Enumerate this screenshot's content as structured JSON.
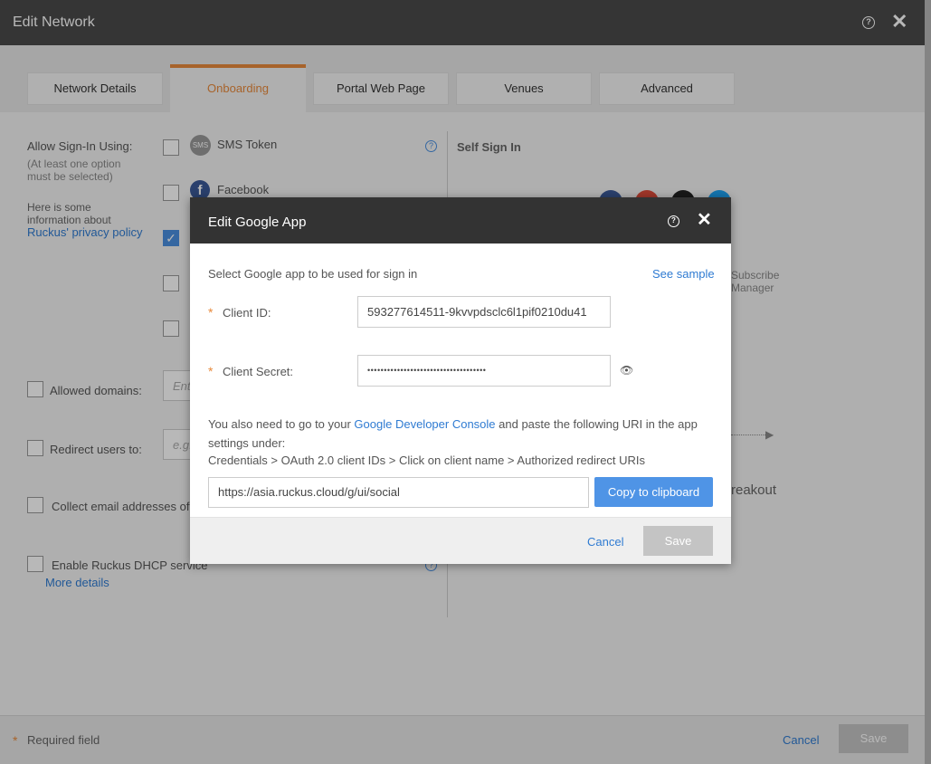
{
  "window": {
    "title": "Edit Network"
  },
  "tabs": [
    {
      "label": "Network Details"
    },
    {
      "label": "Onboarding"
    },
    {
      "label": "Portal Web Page"
    },
    {
      "label": "Venues"
    },
    {
      "label": "Advanced"
    }
  ],
  "onboarding": {
    "allow_label": "Allow Sign-In Using:",
    "allow_note_1": "(At least one option",
    "allow_note_2": "must be selected)",
    "info_1": "Here is some",
    "info_2": "information about",
    "privacy_link": "Ruckus' privacy policy",
    "options": [
      {
        "label": "SMS Token",
        "icon_text": "SMS",
        "checked": false
      },
      {
        "label": "Facebook",
        "icon_text": "f",
        "checked": false
      },
      {
        "label": "",
        "checked": true
      },
      {
        "label": "",
        "checked": false
      },
      {
        "label": "",
        "checked": false
      }
    ],
    "allowed_domains_label": "Allowed domains:",
    "allowed_domains_placeholder": "Ent",
    "redirect_label": "Redirect users to:",
    "redirect_placeholder": "e.g.",
    "collect_email_label": "Collect email addresses of",
    "dhcp_label": "Enable Ruckus DHCP service",
    "more_details": "More details",
    "self_sign_in_title": "Self Sign In",
    "subscribe_1": "Subscribe",
    "subscribe_2": "Manager",
    "breakout": "reakout"
  },
  "footer": {
    "required_star": "*",
    "required_text": "Required field",
    "cancel_label": "Cancel",
    "save_label": "Save"
  },
  "modal": {
    "title": "Edit Google App",
    "select_text": "Select Google app to be used for sign in",
    "see_sample": "See sample",
    "required_star": "*",
    "client_id_label": "Client ID:",
    "client_id_value": "593277614511-9kvvpdsclc6l1pif0210du41",
    "client_secret_label": "Client Secret:",
    "client_secret_value": "••••••••••••••••••••••••••••••••••••",
    "info_prefix": "You also need to go to your ",
    "info_link": "Google Developer Console",
    "info_suffix": " and paste the following URI in the app settings under:",
    "path_text": "Credentials > OAuth 2.0 client IDs > Click on client name > Authorized redirect URIs",
    "redirect_uri": "https://asia.ruckus.cloud/g/ui/social",
    "copy_label": "Copy to clipboard",
    "cancel_label": "Cancel",
    "save_label": "Save"
  },
  "colors": {
    "accent": "#e88a3c",
    "link": "#2f7bd2",
    "primary_button": "#4f94e6",
    "header_bg": "#4a4a4a",
    "modal_header_bg": "#333333",
    "disabled_button": "#c4c4c4",
    "facebook": "#3b5998",
    "google": "#dd4b39",
    "twitter": "#1da1f2"
  }
}
